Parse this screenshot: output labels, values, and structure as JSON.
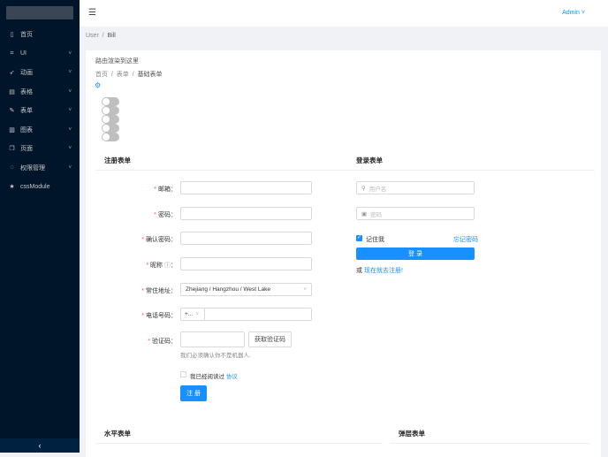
{
  "sidebar": {
    "items": [
      {
        "label": "首页",
        "icon": "mobile-icon",
        "sub": false
      },
      {
        "label": "UI",
        "icon": "ui-icon",
        "sub": true
      },
      {
        "label": "动画",
        "icon": "rocket-icon",
        "sub": true
      },
      {
        "label": "表格",
        "icon": "table-icon",
        "sub": true
      },
      {
        "label": "表单",
        "icon": "edit-icon",
        "sub": true
      },
      {
        "label": "图表",
        "icon": "chart-icon",
        "sub": true
      },
      {
        "label": "页面",
        "icon": "pages-icon",
        "sub": true
      },
      {
        "label": "权限管理",
        "icon": "safety-icon",
        "sub": true
      },
      {
        "label": "cssModule",
        "icon": "star-icon",
        "sub": false
      }
    ],
    "collapse": "‹"
  },
  "header": {
    "user": "Admin"
  },
  "breadcrumb": {
    "user": "User",
    "sep": "/",
    "bill": "Bill"
  },
  "content": {
    "route_text": "路由渲染到这里",
    "crumbs": [
      "首页",
      "表单",
      "基础表单"
    ],
    "sep": "/"
  },
  "register": {
    "title": "注册表单",
    "fields": [
      {
        "label": "邮箱",
        "value": ""
      },
      {
        "label": "密码",
        "value": ""
      },
      {
        "label": "确认密码",
        "value": ""
      },
      {
        "label": "昵称",
        "value": ""
      },
      {
        "label": "常住地址",
        "value": "Zhejiang / Hangzhou / West Lake"
      },
      {
        "label": "电话号码",
        "value": "",
        "prefix": "+..."
      },
      {
        "label": "验证码",
        "value": ""
      }
    ],
    "captcha_button": "获取验证码",
    "captcha_help": "我们必须确认你不是机器人.",
    "agree_text": "我已经阅读过",
    "agree_link": "协议",
    "submit": "注 册"
  },
  "login": {
    "title": "登录表单",
    "username_placeholder": "用户名",
    "password_placeholder": "密码",
    "remember": "记住我",
    "forgot": "忘记密码",
    "submit": "登 录",
    "or": "或",
    "register_link": "现在就去注册!"
  },
  "horizontal": {
    "title": "水平表单"
  },
  "modal": {
    "title": "弹层表单"
  }
}
